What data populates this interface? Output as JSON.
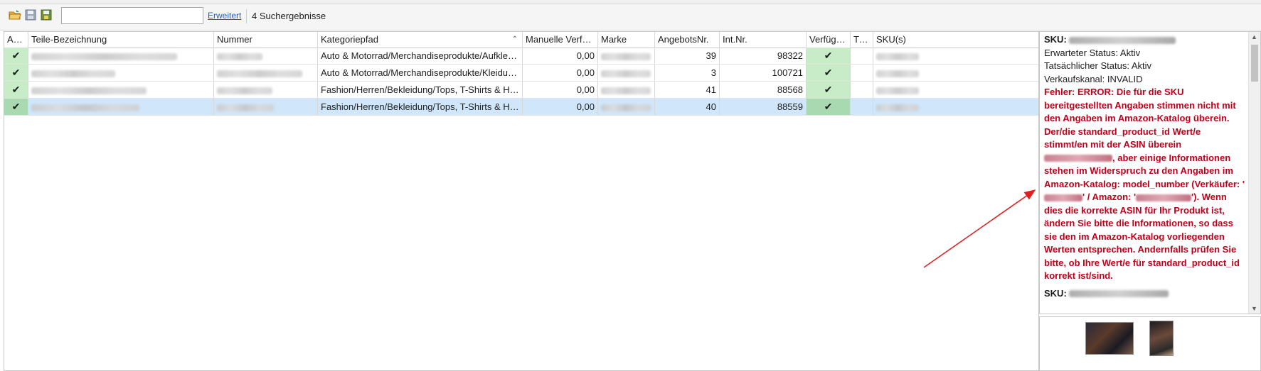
{
  "toolbar": {
    "search_value": "",
    "search_placeholder": "",
    "advanced_link": "Erweitert",
    "result_count": "4 Suchergebnisse"
  },
  "columns": {
    "aktiv": "Aktiv",
    "teile": "Teile-Bezeichnung",
    "nummer": "Nummer",
    "kategoriepfad": "Kategoriepfad",
    "manuelle": "Manuelle Verfüg…",
    "marke": "Marke",
    "angebots": "AngebotsNr.",
    "intnr": "Int.Nr.",
    "verfuegbar": "Verfügbar",
    "titel": "Titel",
    "skus": "SKU(s)"
  },
  "rows": [
    {
      "kategoriepfad": "Auto & Motorrad/Merchandiseprodukte/Aufkleber",
      "manuelle": "0,00",
      "angebots": "39",
      "intnr": "98322"
    },
    {
      "kategoriepfad": "Auto & Motorrad/Merchandiseprodukte/Kleidun…",
      "manuelle": "0,00",
      "angebots": "3",
      "intnr": "100721"
    },
    {
      "kategoriepfad": "Fashion/Herren/Bekleidung/Tops, T-Shirts & Hem…",
      "manuelle": "0,00",
      "angebots": "41",
      "intnr": "88568"
    },
    {
      "kategoriepfad": "Fashion/Herren/Bekleidung/Tops, T-Shirts & Hem…",
      "manuelle": "0,00",
      "angebots": "40",
      "intnr": "88559"
    }
  ],
  "detail": {
    "sku_label": "SKU:",
    "expected_status": "Erwarteter Status: Aktiv",
    "actual_status": "Tatsächlicher Status: Aktiv",
    "channel": "Verkaufskanal: INVALID",
    "error_part1": "Fehler: ERROR: Die für die SKU bereitgestellten Angaben stimmen nicht mit den Angaben im Amazon-Katalog überein.  Der/die standard_product_id Wert/e stimmt/en mit der ASIN überein",
    "error_part2": ", aber einige Informationen stehen im Widerspruch zu den Angaben im Amazon-Katalog: model_number (Verkäufer: '",
    "error_part3": "' / Amazon: '",
    "error_part4": "'). Wenn dies die korrekte ASIN für Ihr Produkt ist, ändern Sie bitte die Informationen, so dass sie den im Amazon-Katalog vorliegenden Werten entsprechen. Andernfalls prüfen Sie bitte, ob Ihre Wert/e für standard_product_id korrekt ist/sind.",
    "sku2_label": "SKU:"
  },
  "colors": {
    "accent_link": "#1a5fc8",
    "error_text": "#c0001a",
    "selected_row": "#cfe6fb",
    "available_cell": "#c8ecc8"
  },
  "icons": [
    "open-folder-icon",
    "save-icon",
    "save-as-icon",
    "checkmark-icon",
    "sort-ascending-icon",
    "scroll-up-icon",
    "scroll-down-icon"
  ]
}
